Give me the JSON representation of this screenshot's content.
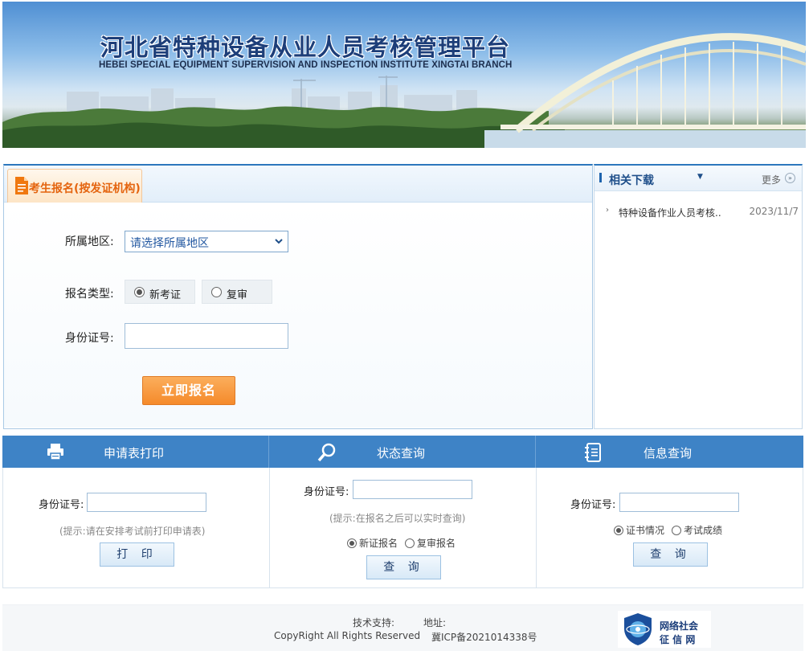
{
  "banner": {
    "title": "河北省特种设备从业人员考核管理平台",
    "subtitle": "HEBEI SPECIAL EQUIPMENT SUPERVISION AND INSPECTION INSTITUTE  XINGTAI BRANCH"
  },
  "registration": {
    "tab_label": "考生报名(按发证机构)",
    "region_label": "所属地区:",
    "region_selected": "请选择所属地区",
    "type_label": "报名类型:",
    "type_options": [
      {
        "label": "新考证",
        "selected": true
      },
      {
        "label": "复审",
        "selected": false
      }
    ],
    "id_label": "身份证号:",
    "id_value": "",
    "submit_label": "立即报名"
  },
  "downloads": {
    "title": "相关下载",
    "more_label": "更多",
    "items": [
      {
        "name": "特种设备作业人员考核..",
        "date": "2023/11/7"
      }
    ]
  },
  "panels": {
    "print": {
      "title": "申请表打印",
      "icon": "printer-icon",
      "id_label": "身份证号:",
      "hint": "(提示:请在安排考试前打印申请表)",
      "button": "打 印"
    },
    "status": {
      "title": "状态查询",
      "icon": "magnifier-icon",
      "id_label": "身份证号:",
      "hint": "(提示:在报名之后可以实时查询)",
      "options": [
        {
          "label": "新证报名",
          "selected": true
        },
        {
          "label": "复审报名",
          "selected": false
        }
      ],
      "button": "查 询"
    },
    "info": {
      "title": "信息查询",
      "icon": "notebook-icon",
      "id_label": "身份证号:",
      "options": [
        {
          "label": "证书情况",
          "selected": true
        },
        {
          "label": "考试成绩",
          "selected": false
        }
      ],
      "button": "查 询"
    }
  },
  "footer": {
    "tech_support": "技术支持:",
    "address": "地址:",
    "copyright": "CopyRight All Rights Reserved",
    "icp": "冀ICP备2021014338号",
    "badge_line1": "网络社会",
    "badge_line2": "征 信 网"
  },
  "colors": {
    "primary_blue": "#3e83c6",
    "accent_orange": "#f58a2b",
    "title_blue": "#1d3e79"
  }
}
